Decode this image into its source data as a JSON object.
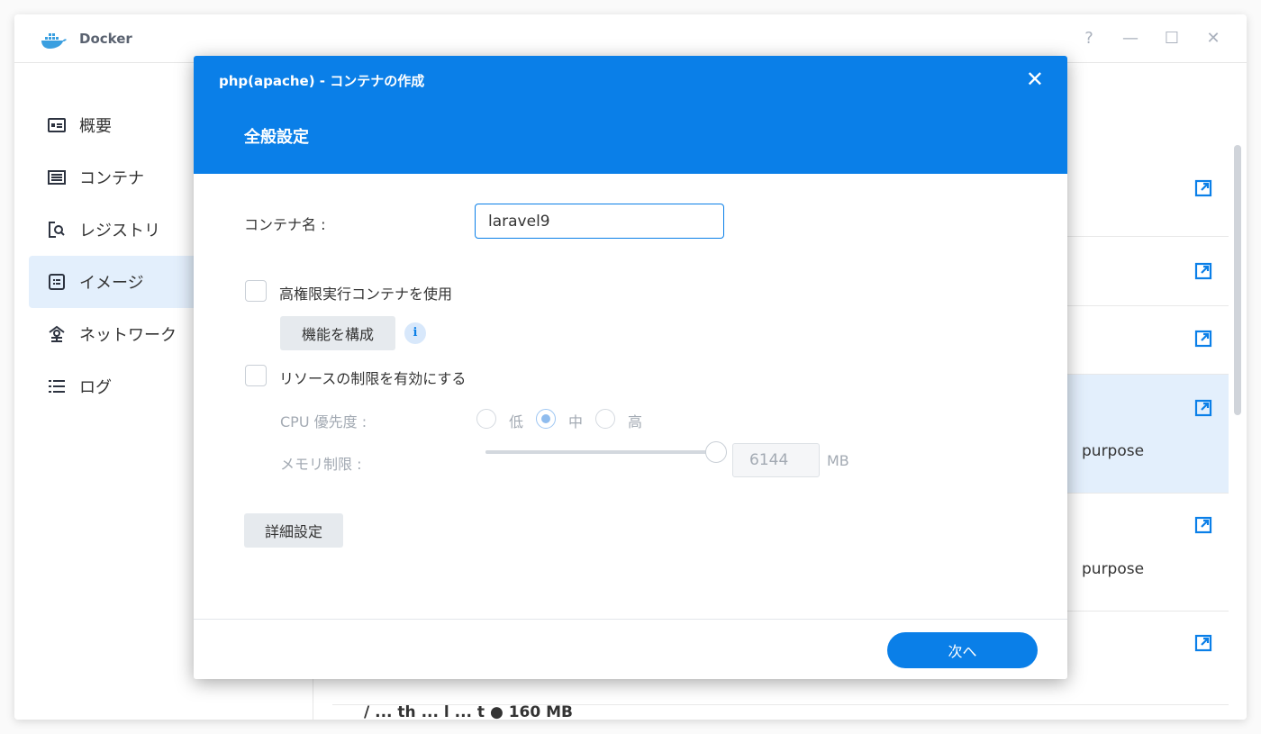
{
  "app": {
    "title": "Docker"
  },
  "window_controls": {
    "help": "?",
    "minimize": "—",
    "maximize": "☐",
    "close": "✕"
  },
  "sidebar": {
    "items": [
      {
        "label": "概要",
        "icon": "overview-icon"
      },
      {
        "label": "コンテナ",
        "icon": "container-icon"
      },
      {
        "label": "レジストリ",
        "icon": "registry-icon"
      },
      {
        "label": "イメージ",
        "icon": "image-icon",
        "active": true
      },
      {
        "label": "ネットワーク",
        "icon": "network-icon"
      },
      {
        "label": "ログ",
        "icon": "log-icon"
      }
    ]
  },
  "background_list": {
    "row_texts": [
      "purpose",
      "purpose"
    ],
    "partial_text": "/ ... th ... l ... t  ● 160 MB"
  },
  "dialog": {
    "title": "php(apache) - コンテナの作成",
    "close": "✕",
    "section": "全般設定",
    "container_name_label": "コンテナ名 :",
    "container_name_value": "laravel9",
    "privileged_label": "高権限実行コンテナを使用",
    "configure_button": "機能を構成",
    "info": "i",
    "resource_limit_label": "リソースの制限を有効にする",
    "cpu_priority_label": "CPU 優先度 :",
    "cpu_options": [
      "低",
      "中",
      "高"
    ],
    "cpu_selected": "中",
    "memory_limit_label": "メモリ制限 :",
    "memory_value": "6144",
    "memory_unit": "MB",
    "memory_slider_level": 1.0,
    "advanced_button": "詳細設定",
    "next_button": "次へ"
  },
  "colors": {
    "accent": "#0a7fe8",
    "selected_bg": "#e3effc"
  }
}
